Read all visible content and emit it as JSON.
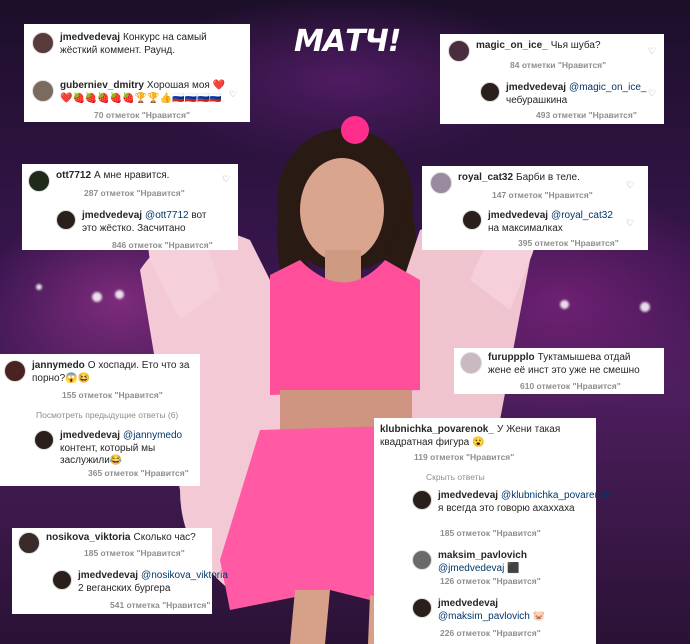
{
  "logo": "МАТЧ!",
  "comments": {
    "c1": {
      "user": "jmedvedevaj",
      "text": "Конкурс на самый жёсткий коммент. Раунд.",
      "reply_user": "guberniev_dmitry",
      "reply_text": "Хорошая моя ❤️❤️🍓🍓🍓🍓🍓🏆🏆👍🇷🇺🇷🇺🇷🇺🇷🇺",
      "reply_likes": "70 отметок \"Нравится\""
    },
    "c2": {
      "user": "magic_on_ice_",
      "text": "Чья шуба?",
      "likes": "84 отметки \"Нравится\"",
      "reply_user": "jmedvedevaj",
      "reply_mention": "@magic_on_ice_",
      "reply_text": "чебурашкина",
      "reply_likes": "493 отметки \"Нравится\""
    },
    "c3": {
      "user": "ott7712",
      "text": "А мне нравится.",
      "likes": "287 отметок \"Нравится\"",
      "reply_user": "jmedvedevaj",
      "reply_mention": "@ott7712",
      "reply_text": "вот это жёстко. Засчитано",
      "reply_likes": "846 отметок \"Нравится\""
    },
    "c4": {
      "user": "royal_cat32",
      "text": "Барби в теле.",
      "likes": "147 отметок \"Нравится\"",
      "reply_user": "jmedvedevaj",
      "reply_mention": "@royal_cat32",
      "reply_text": "на максималках",
      "reply_likes": "395 отметок \"Нравится\""
    },
    "c5": {
      "user": "jannymedo",
      "text": "О хоспади. Ето что за порно?😱😆",
      "likes": "155 отметок \"Нравится\"",
      "view_prev": "Посмотреть предыдущие ответы (6)",
      "reply_user": "jmedvedevaj",
      "reply_mention": "@jannymedo",
      "reply_text": "контент, который мы заслужили😂",
      "reply_likes": "365 отметок \"Нравится\""
    },
    "c6": {
      "user": "furuppplo",
      "text": "Туктамышева отдай жене её инст это уже не смешно",
      "likes": "610 отметок \"Нравится\""
    },
    "c7": {
      "user": "klubnichka_povarenok_",
      "text": "У Жени такая квадратная фигура 😮",
      "likes": "119 отметок \"Нравится\"",
      "hide": "Скрыть ответы",
      "r1_user": "jmedvedevaj",
      "r1_mention": "@klubnichka_povarenok_",
      "r1_text": "я всегда это говорю ахаххаха",
      "r1_likes": "185 отметок \"Нравится\"",
      "r2_user": "maksim_pavlovich",
      "r2_mention": "@jmedvedevaj",
      "r2_text": "⬛",
      "r2_likes": "126 отметок \"Нравится\"",
      "r3_user": "jmedvedevaj",
      "r3_mention": "@maksim_pavlovich",
      "r3_text": "🐷",
      "r3_likes": "226 отметок \"Нравится\""
    },
    "c8": {
      "user": "nosikova_viktoria",
      "text": "Сколько час?",
      "likes": "185 отметок \"Нравится\"",
      "reply_user": "jmedvedevaj",
      "reply_mention": "@nosikova_viktoria",
      "reply_text": "2 веганских бургера",
      "reply_likes": "541 отметка \"Нравится\""
    }
  },
  "colors": {
    "costume": "#ff4f9a",
    "jacket": "#f2c9d4",
    "bg": "#3a1650"
  }
}
